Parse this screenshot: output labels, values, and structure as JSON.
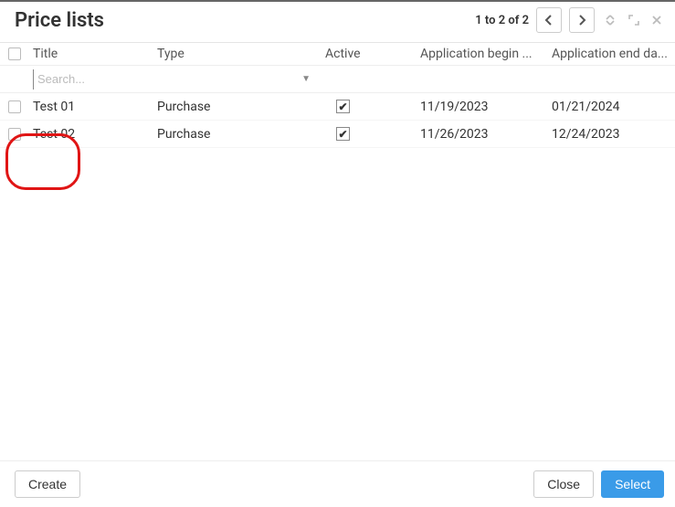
{
  "header": {
    "title": "Price lists",
    "pager_text": "1 to 2 of 2"
  },
  "columns": {
    "title": "Title",
    "type": "Type",
    "active": "Active",
    "begin": "Application begin ...",
    "end": "Application end da..."
  },
  "filters": {
    "title_placeholder": "Search..."
  },
  "rows": [
    {
      "title": "Test 01",
      "type": "Purchase",
      "active": true,
      "begin": "11/19/2023",
      "end": "01/21/2024"
    },
    {
      "title": "Test 02",
      "type": "Purchase",
      "active": true,
      "begin": "11/26/2023",
      "end": "12/24/2023"
    }
  ],
  "footer": {
    "create": "Create",
    "close": "Close",
    "select": "Select"
  }
}
